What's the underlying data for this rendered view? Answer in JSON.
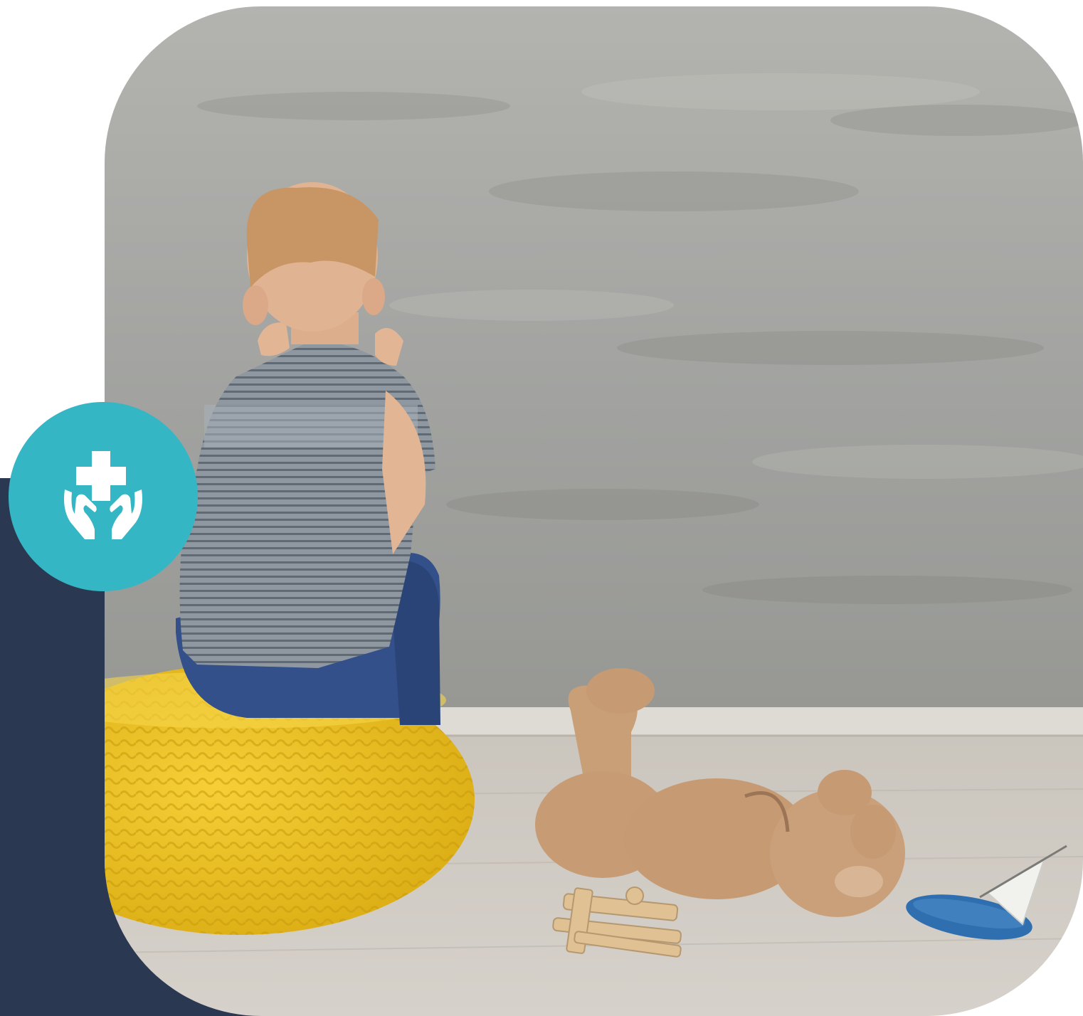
{
  "colors": {
    "navy": "#2b3852",
    "teal": "#35b6c4",
    "icon_fill": "#ffffff",
    "wall": "#a4a5a2",
    "floor": "#cbc4bb",
    "pouf": "#f0c428",
    "teddy": "#c79c75",
    "shirt": "#8c959d",
    "jeans": "#34508a",
    "hair": "#c89565",
    "skin": "#e2b695",
    "boat": "#2f6fb0",
    "plane": "#dfc193"
  },
  "badge": {
    "icon": "medical-care-hands-icon"
  },
  "photo": {
    "subject": "child-sitting-on-pouf-photo",
    "objects": [
      "boy",
      "yellow-knit-pouf",
      "teddy-bear",
      "wooden-toy-plane",
      "toy-sailboat"
    ]
  }
}
